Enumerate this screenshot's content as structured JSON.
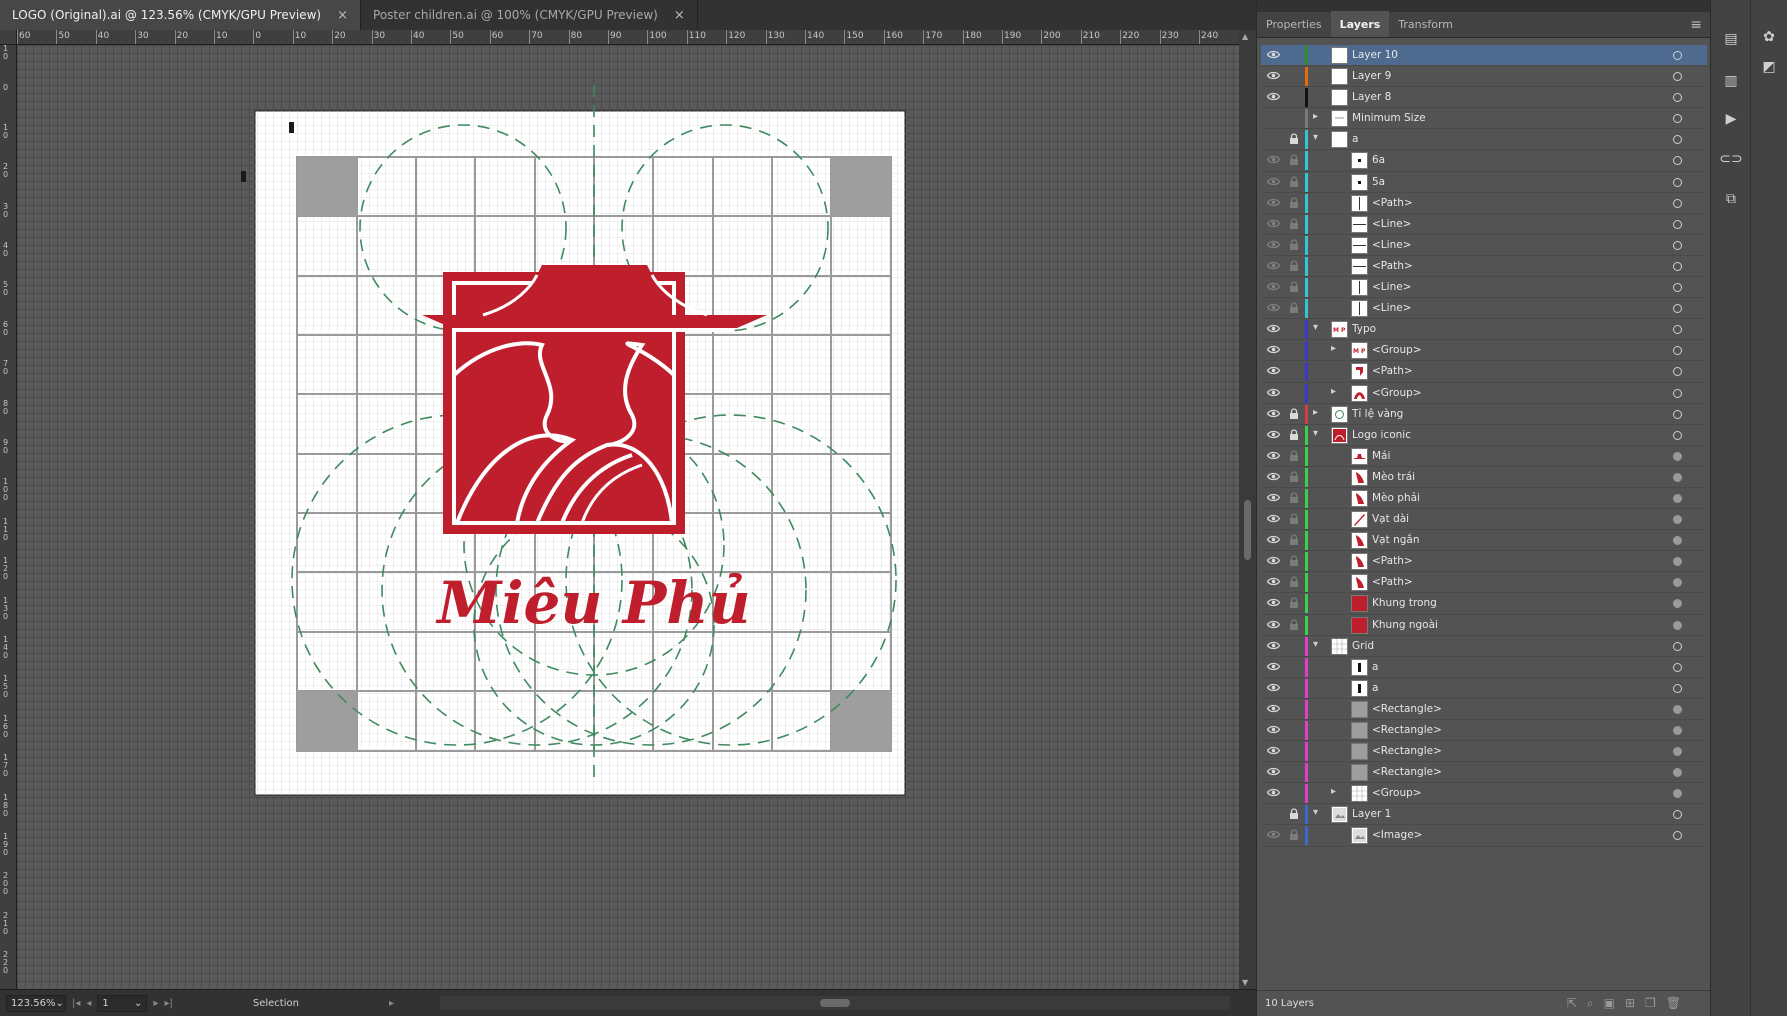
{
  "doc_tabs": [
    {
      "title": "LOGO (Original).ai @ 123.56% (CMYK/GPU Preview)",
      "close": "×"
    },
    {
      "title": "Poster children.ai @ 100% (CMYK/GPU Preview)",
      "close": "×"
    }
  ],
  "ruler_top_labels": [
    "60",
    "50",
    "40",
    "30",
    "20",
    "10",
    "0",
    "10",
    "20",
    "30",
    "40",
    "50",
    "60",
    "70",
    "80",
    "90",
    "100",
    "110",
    "120",
    "130",
    "140",
    "150",
    "160",
    "170",
    "180",
    "190",
    "200",
    "210",
    "220",
    "230",
    "240"
  ],
  "ruler_left_labels": [
    "1 0",
    "0",
    "1 0",
    "2 0",
    "3 0",
    "4 0",
    "5 0",
    "6 0",
    "7 0",
    "8 0",
    "9 0",
    "1 0 0",
    "1 1 0",
    "1 2 0",
    "1 3 0",
    "1 4 0",
    "1 5 0",
    "1 6 0",
    "1 7 0",
    "1 8 0",
    "1 9 0",
    "2 0 0",
    "2 1 0",
    "2 2 0"
  ],
  "artwork": {
    "brand_text": "Miêu Phủ",
    "brand_red": "#bf1f2d",
    "guide_green": "#3f8a5f",
    "grid_gray": "#9a9a9a"
  },
  "status": {
    "zoom": "123.56%",
    "artboard": "1",
    "tool": "Selection"
  },
  "panel": {
    "tabs": [
      "Properties",
      "Layers",
      "Transform"
    ],
    "active_tab": "Layers",
    "menu": "≡",
    "footer": "10 Layers"
  },
  "layers": [
    {
      "name": "Layer 10",
      "depth": 0,
      "eye": true,
      "lock": false,
      "twisty": "",
      "color": "#2f8f2f",
      "thumb": "blank",
      "selected": true,
      "filled": false
    },
    {
      "name": "Layer 9",
      "depth": 0,
      "eye": true,
      "lock": false,
      "twisty": "",
      "color": "#e06a10",
      "thumb": "blank",
      "selected": false,
      "filled": false
    },
    {
      "name": "Layer 8",
      "depth": 0,
      "eye": true,
      "lock": false,
      "twisty": "",
      "color": "#111111",
      "thumb": "blank",
      "selected": false,
      "filled": false
    },
    {
      "name": "Minimum Size",
      "depth": 0,
      "eye": false,
      "lock": false,
      "twisty": "›",
      "color": "#7a7a7a",
      "thumb": "minsize",
      "selected": false,
      "filled": false
    },
    {
      "name": "a",
      "depth": 0,
      "eye": false,
      "lock": true,
      "twisty": "⌄",
      "color": "#2ec8d8",
      "thumb": "blank",
      "selected": false,
      "filled": false
    },
    {
      "name": "6a",
      "depth": 1,
      "eye": "dim",
      "lock": "dim",
      "twisty": "",
      "color": "#2ec8d8",
      "thumb": "dot",
      "selected": false,
      "filled": false
    },
    {
      "name": "5a",
      "depth": 1,
      "eye": "dim",
      "lock": "dim",
      "twisty": "",
      "color": "#2ec8d8",
      "thumb": "dot",
      "selected": false,
      "filled": false
    },
    {
      "name": "<Path>",
      "depth": 1,
      "eye": "dim",
      "lock": "dim",
      "twisty": "",
      "color": "#2ec8d8",
      "thumb": "vline",
      "selected": false,
      "filled": false
    },
    {
      "name": "<Line>",
      "depth": 1,
      "eye": "dim",
      "lock": "dim",
      "twisty": "",
      "color": "#2ec8d8",
      "thumb": "hline",
      "selected": false,
      "filled": false
    },
    {
      "name": "<Line>",
      "depth": 1,
      "eye": "dim",
      "lock": "dim",
      "twisty": "",
      "color": "#2ec8d8",
      "thumb": "hline",
      "selected": false,
      "filled": false
    },
    {
      "name": "<Path>",
      "depth": 1,
      "eye": "dim",
      "lock": "dim",
      "twisty": "",
      "color": "#2ec8d8",
      "thumb": "hline",
      "selected": false,
      "filled": false
    },
    {
      "name": "<Line>",
      "depth": 1,
      "eye": "dim",
      "lock": "dim",
      "twisty": "",
      "color": "#2ec8d8",
      "thumb": "vline",
      "selected": false,
      "filled": false
    },
    {
      "name": "<Line>",
      "depth": 1,
      "eye": "dim",
      "lock": "dim",
      "twisty": "",
      "color": "#2ec8d8",
      "thumb": "vline",
      "selected": false,
      "filled": false
    },
    {
      "name": "Typo",
      "depth": 0,
      "eye": true,
      "lock": false,
      "twisty": "⌄",
      "color": "#3a3ac8",
      "thumb": "typo",
      "selected": false,
      "filled": false
    },
    {
      "name": "<Group>",
      "depth": 1,
      "eye": true,
      "lock": false,
      "twisty": "›",
      "color": "#3a3ac8",
      "thumb": "typo",
      "selected": false,
      "filled": false
    },
    {
      "name": "<Path>",
      "depth": 1,
      "eye": true,
      "lock": false,
      "twisty": "",
      "color": "#3a3ac8",
      "thumb": "redmark",
      "selected": false,
      "filled": false
    },
    {
      "name": "<Group>",
      "depth": 1,
      "eye": true,
      "lock": false,
      "twisty": "›",
      "color": "#3a3ac8",
      "thumb": "redarc",
      "selected": false,
      "filled": false
    },
    {
      "name": "Tỉ lệ vàng",
      "depth": 0,
      "eye": true,
      "lock": true,
      "twisty": "›",
      "color": "#d04040",
      "thumb": "golden",
      "selected": false,
      "filled": false
    },
    {
      "name": "Logo iconic",
      "depth": 0,
      "eye": true,
      "lock": true,
      "twisty": "⌄",
      "color": "#3ad04a",
      "thumb": "logo",
      "selected": false,
      "filled": false
    },
    {
      "name": "Mái",
      "depth": 1,
      "eye": true,
      "lock": "dim",
      "twisty": "",
      "color": "#3ad04a",
      "thumb": "redroof",
      "selected": false,
      "filled": true
    },
    {
      "name": "Mèo trái",
      "depth": 1,
      "eye": true,
      "lock": "dim",
      "twisty": "",
      "color": "#3ad04a",
      "thumb": "redshape",
      "selected": false,
      "filled": true
    },
    {
      "name": "Mèo phải",
      "depth": 1,
      "eye": true,
      "lock": "dim",
      "twisty": "",
      "color": "#3ad04a",
      "thumb": "redshape",
      "selected": false,
      "filled": true
    },
    {
      "name": "Vạt dài",
      "depth": 1,
      "eye": true,
      "lock": "dim",
      "twisty": "",
      "color": "#3ad04a",
      "thumb": "redslash",
      "selected": false,
      "filled": true
    },
    {
      "name": "Vạt ngắn",
      "depth": 1,
      "eye": true,
      "lock": "dim",
      "twisty": "",
      "color": "#3ad04a",
      "thumb": "redshape",
      "selected": false,
      "filled": true
    },
    {
      "name": "<Path>",
      "depth": 1,
      "eye": true,
      "lock": "dim",
      "twisty": "",
      "color": "#3ad04a",
      "thumb": "redshape",
      "selected": false,
      "filled": true
    },
    {
      "name": "<Path>",
      "depth": 1,
      "eye": true,
      "lock": "dim",
      "twisty": "",
      "color": "#3ad04a",
      "thumb": "redshape",
      "selected": false,
      "filled": true
    },
    {
      "name": "Khung trong",
      "depth": 1,
      "eye": true,
      "lock": "dim",
      "twisty": "",
      "color": "#3ad04a",
      "thumb": "redsolid",
      "selected": false,
      "filled": true
    },
    {
      "name": "Khung ngoài",
      "depth": 1,
      "eye": true,
      "lock": "dim",
      "twisty": "",
      "color": "#3ad04a",
      "thumb": "redsolid",
      "selected": false,
      "filled": true
    },
    {
      "name": "Grid",
      "depth": 0,
      "eye": true,
      "lock": false,
      "twisty": "⌄",
      "color": "#e040c8",
      "thumb": "grid",
      "selected": false,
      "filled": false
    },
    {
      "name": "a",
      "depth": 1,
      "eye": true,
      "lock": false,
      "twisty": "",
      "color": "#e040c8",
      "thumb": "blackbar",
      "selected": false,
      "filled": false
    },
    {
      "name": "a",
      "depth": 1,
      "eye": true,
      "lock": false,
      "twisty": "",
      "color": "#e040c8",
      "thumb": "blackbar",
      "selected": false,
      "filled": false
    },
    {
      "name": "<Rectangle>",
      "depth": 1,
      "eye": true,
      "lock": false,
      "twisty": "",
      "color": "#e040c8",
      "thumb": "gray",
      "selected": false,
      "filled": true
    },
    {
      "name": "<Rectangle>",
      "depth": 1,
      "eye": true,
      "lock": false,
      "twisty": "",
      "color": "#e040c8",
      "thumb": "gray",
      "selected": false,
      "filled": true
    },
    {
      "name": "<Rectangle>",
      "depth": 1,
      "eye": true,
      "lock": false,
      "twisty": "",
      "color": "#e040c8",
      "thumb": "gray",
      "selected": false,
      "filled": true
    },
    {
      "name": "<Rectangle>",
      "depth": 1,
      "eye": true,
      "lock": false,
      "twisty": "",
      "color": "#e040c8",
      "thumb": "gray",
      "selected": false,
      "filled": true
    },
    {
      "name": "<Group>",
      "depth": 1,
      "eye": true,
      "lock": false,
      "twisty": "›",
      "color": "#e040c8",
      "thumb": "grid",
      "selected": false,
      "filled": true
    },
    {
      "name": "Layer 1",
      "depth": 0,
      "eye": false,
      "lock": true,
      "twisty": "⌄",
      "color": "#3a6ad0",
      "thumb": "image",
      "selected": false,
      "filled": false
    },
    {
      "name": "<Image>",
      "depth": 1,
      "eye": "dim",
      "lock": "dim",
      "twisty": "",
      "color": "#3a6ad0",
      "thumb": "image",
      "selected": false,
      "filled": false
    }
  ]
}
